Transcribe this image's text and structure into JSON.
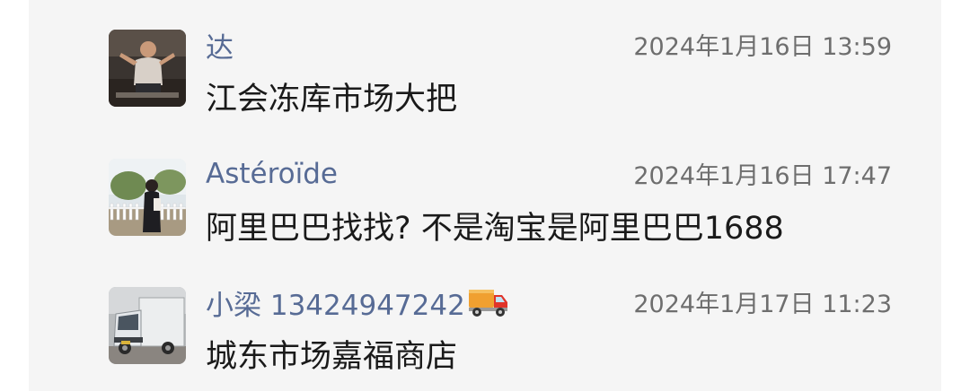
{
  "comments": [
    {
      "name": "达",
      "time": "2024年1月16日 13:59",
      "text": "江会冻库市场大把",
      "avatar": "avatar-person-gym"
    },
    {
      "name": "Astéroïde",
      "time": "2024年1月16日 17:47",
      "text": "阿里巴巴找找? 不是淘宝是阿里巴巴1688",
      "avatar": "avatar-person-outdoor"
    },
    {
      "name": "小梁 13424947242",
      "name_emoji": "truck-icon",
      "time": "2024年1月17日 11:23",
      "text": "城东市场嘉福商店",
      "avatar": "avatar-truck-photo"
    }
  ],
  "colors": {
    "name": "#576b95",
    "time": "#6e6e6e",
    "text": "#1a1a1a",
    "panel": "#f5f5f5"
  }
}
